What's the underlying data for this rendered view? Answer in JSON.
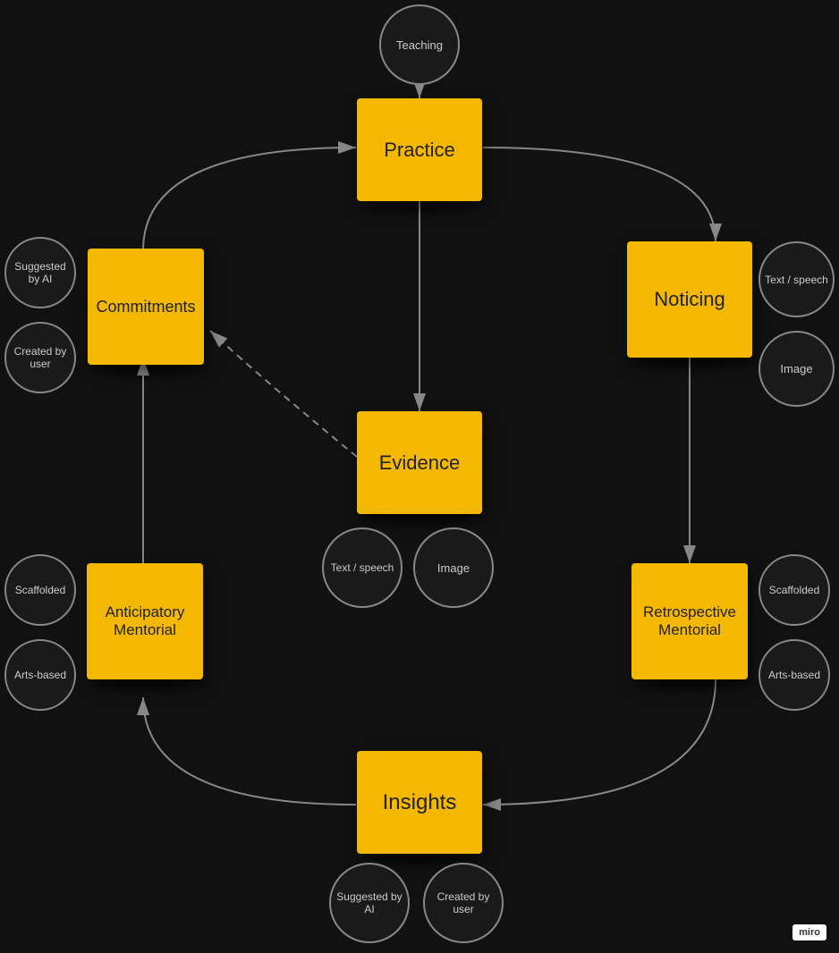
{
  "nodes": {
    "teaching": {
      "label": "Teaching"
    },
    "practice": {
      "label": "Practice"
    },
    "noticing": {
      "label": "Noticing"
    },
    "evidence": {
      "label": "Evidence"
    },
    "commitments": {
      "label": "Commitments"
    },
    "anticipatory": {
      "label": "Anticipatory Mentorial"
    },
    "retrospective": {
      "label": "Retrospective Mentorial"
    },
    "insights": {
      "label": "Insights"
    }
  },
  "circles": {
    "suggested_ai_left": {
      "label": "Suggested by AI"
    },
    "created_user_left": {
      "label": "Created by user"
    },
    "text_speech_right_top": {
      "label": "Text / speech"
    },
    "image_right_top": {
      "label": "Image"
    },
    "text_speech_center": {
      "label": "Text / speech"
    },
    "image_center": {
      "label": "Image"
    },
    "scaffolded_left": {
      "label": "Scaffolded"
    },
    "arts_based_left": {
      "label": "Arts-based"
    },
    "scaffolded_right": {
      "label": "Scaffolded"
    },
    "arts_based_right": {
      "label": "Arts-based"
    },
    "suggested_ai_bottom": {
      "label": "Suggested by AI"
    },
    "created_user_bottom": {
      "label": "Created by user"
    }
  },
  "badge": {
    "label": "miro"
  }
}
